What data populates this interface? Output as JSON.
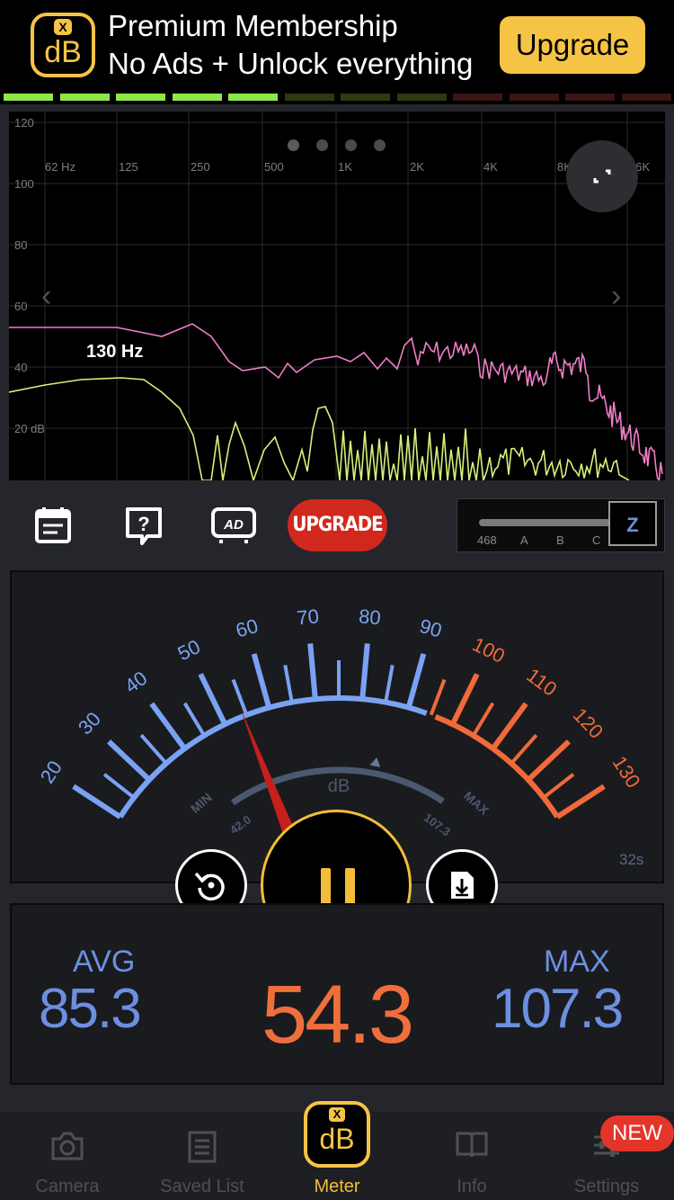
{
  "banner": {
    "icon_x": "X",
    "icon_text": "dB",
    "title": "Premium Membership",
    "subtitle": "No Ads + Unlock everything",
    "upgrade_label": "Upgrade",
    "accent_color": "#f6c445"
  },
  "level_bar": {
    "segments_lit": 5,
    "segments_total": 12
  },
  "spectrum": {
    "y_labels": [
      "120",
      "100",
      "80",
      "60",
      "40",
      "20 dB"
    ],
    "x_labels": [
      "62 Hz",
      "125",
      "250",
      "500",
      "1K",
      "2K",
      "4K",
      "8K",
      "16K"
    ],
    "frequency_label": "130 Hz",
    "page_dots": 4,
    "series_colors": {
      "peak": "#f07ec8",
      "current": "#d6f27a"
    }
  },
  "toolbar": {
    "icons": [
      "calendar-icon",
      "help-icon",
      "ad-icon"
    ],
    "upgrade_label": "UPGRADE",
    "weighting": {
      "options": [
        "468",
        "A",
        "B",
        "C"
      ],
      "selected": "Z"
    }
  },
  "meter": {
    "scale_blue": [
      "20",
      "30",
      "40",
      "50",
      "60",
      "70",
      "80",
      "90"
    ],
    "scale_orange": [
      "100",
      "110",
      "120",
      "130"
    ],
    "min_label": "MIN",
    "max_label": "MAX",
    "min_value": "42.0",
    "max_value": "107.3",
    "unit": "dB",
    "timer": "32s",
    "needle_value": 54.3,
    "colors": {
      "blue": "#7aa2f2",
      "orange": "#f06a3a",
      "needle": "#c5201a"
    }
  },
  "controls": {
    "reset_icon": "reset-icon",
    "pause_icon": "pause-icon",
    "save_icon": "save-icon"
  },
  "stats": {
    "avg_label": "AVG",
    "avg_value": "85.3",
    "current_value": "54.3",
    "max_label": "MAX",
    "max_value": "107.3"
  },
  "tabs": [
    {
      "label": "Camera",
      "icon": "camera-icon"
    },
    {
      "label": "Saved List",
      "icon": "list-icon"
    },
    {
      "label": "Meter",
      "icon": "db-app-icon",
      "icon_x": "X",
      "icon_text": "dB"
    },
    {
      "label": "Info",
      "icon": "book-icon"
    },
    {
      "label": "Settings",
      "icon": "settings-icon"
    }
  ],
  "new_badge": "NEW"
}
